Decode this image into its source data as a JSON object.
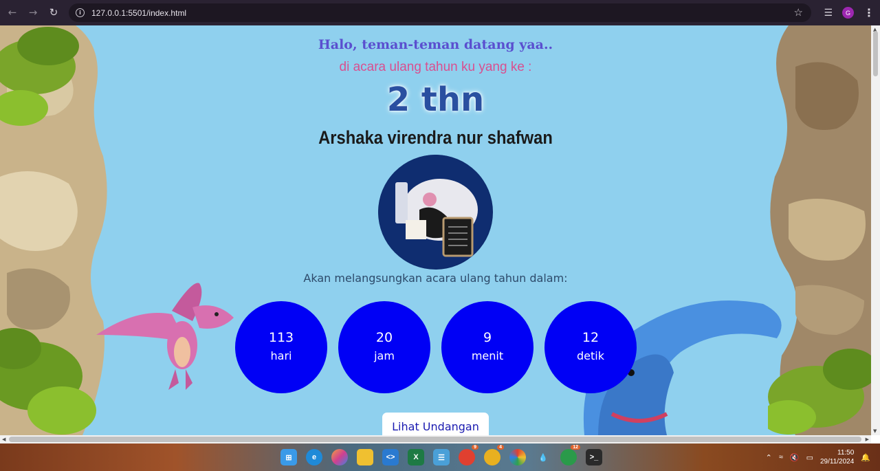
{
  "browser": {
    "url": "127.0.0.1:5501/index.html",
    "profile_initial": "G"
  },
  "page": {
    "greeting": "Halo, teman-teman datang yaa..",
    "subtitle": "di acara ulang tahun ku yang ke :",
    "age": "2 thn",
    "name": "Arshaka virendra nur shafwan",
    "announcement": "Akan melangsungkan acara ulang tahun dalam:",
    "countdown": [
      {
        "value": "113",
        "unit": "hari"
      },
      {
        "value": "20",
        "unit": "jam"
      },
      {
        "value": "9",
        "unit": "menit"
      },
      {
        "value": "12",
        "unit": "detik"
      }
    ],
    "button_label": "Lihat Undangan",
    "colors": {
      "background": "#8fd0ee",
      "countdown_circle": "#0000f5",
      "greeting": "#5a4fcf",
      "subtitle": "#d94f8f",
      "age": "#2a4fa0"
    }
  },
  "taskbar": {
    "time": "11:50",
    "date": "29/11/2024",
    "badges": {
      "copilot": "9",
      "chrome2": "4",
      "whatsapp": "12"
    }
  }
}
